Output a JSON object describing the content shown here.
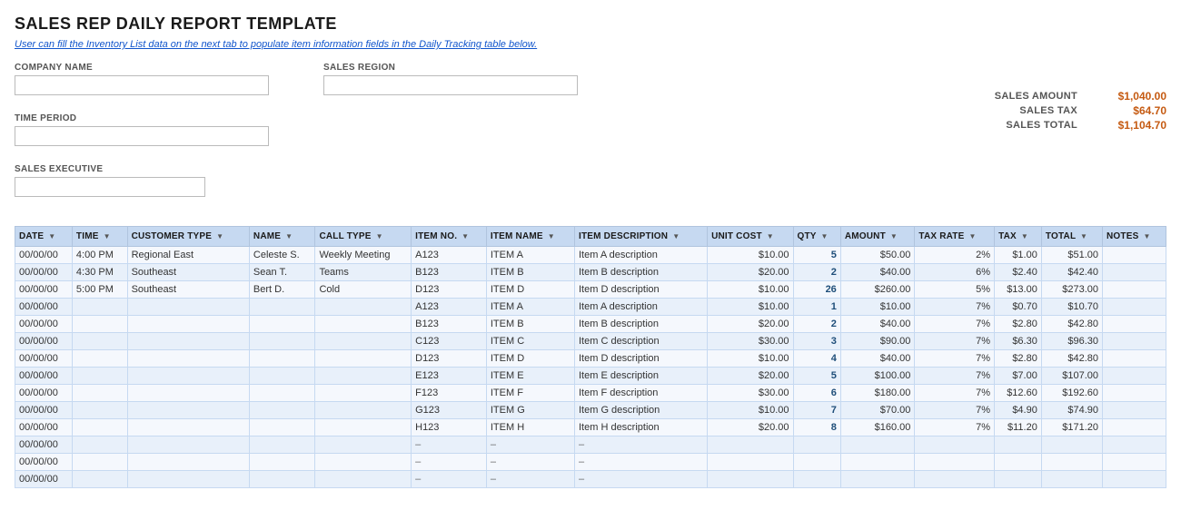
{
  "title": "SALES REP DAILY REPORT TEMPLATE",
  "subtitle_pre": "User can fill the Inventory List data on the next tab to populate item information fields in the ",
  "subtitle_link": "Daily Tracking",
  "subtitle_post": " table below.",
  "fields": {
    "company_name_label": "COMPANY NAME",
    "company_name_value": "",
    "sales_region_label": "SALES REGION",
    "sales_region_value": "",
    "time_period_label": "TIME PERIOD",
    "time_period_value": "",
    "sales_executive_label": "SALES EXECUTIVE",
    "sales_executive_value": ""
  },
  "summary": {
    "sales_amount_label": "SALES AMOUNT",
    "sales_amount_value": "$1,040.00",
    "sales_tax_label": "SALES TAX",
    "sales_tax_value": "$64.70",
    "sales_total_label": "SALES TOTAL",
    "sales_total_value": "$1,104.70"
  },
  "table": {
    "headers": [
      "DATE",
      "TIME",
      "CUSTOMER TYPE",
      "NAME",
      "CALL TYPE",
      "ITEM NO.",
      "ITEM NAME",
      "ITEM DESCRIPTION",
      "UNIT COST",
      "QTY",
      "AMOUNT",
      "TAX RATE",
      "TAX",
      "TOTAL",
      "NOTES"
    ],
    "rows": [
      [
        "00/00/00",
        "4:00 PM",
        "Regional East",
        "Celeste S.",
        "Weekly Meeting",
        "A123",
        "ITEM A",
        "Item A description",
        "$10.00",
        "5",
        "$50.00",
        "2%",
        "$1.00",
        "$51.00",
        ""
      ],
      [
        "00/00/00",
        "4:30 PM",
        "Southeast",
        "Sean T.",
        "Teams",
        "B123",
        "ITEM B",
        "Item B description",
        "$20.00",
        "2",
        "$40.00",
        "6%",
        "$2.40",
        "$42.40",
        ""
      ],
      [
        "00/00/00",
        "5:00 PM",
        "Southeast",
        "Bert D.",
        "Cold",
        "D123",
        "ITEM D",
        "Item D description",
        "$10.00",
        "26",
        "$260.00",
        "5%",
        "$13.00",
        "$273.00",
        ""
      ],
      [
        "00/00/00",
        "",
        "",
        "",
        "",
        "A123",
        "ITEM A",
        "Item A description",
        "$10.00",
        "1",
        "$10.00",
        "7%",
        "$0.70",
        "$10.70",
        ""
      ],
      [
        "00/00/00",
        "",
        "",
        "",
        "",
        "B123",
        "ITEM B",
        "Item B description",
        "$20.00",
        "2",
        "$40.00",
        "7%",
        "$2.80",
        "$42.80",
        ""
      ],
      [
        "00/00/00",
        "",
        "",
        "",
        "",
        "C123",
        "ITEM C",
        "Item C description",
        "$30.00",
        "3",
        "$90.00",
        "7%",
        "$6.30",
        "$96.30",
        ""
      ],
      [
        "00/00/00",
        "",
        "",
        "",
        "",
        "D123",
        "ITEM D",
        "Item D description",
        "$10.00",
        "4",
        "$40.00",
        "7%",
        "$2.80",
        "$42.80",
        ""
      ],
      [
        "00/00/00",
        "",
        "",
        "",
        "",
        "E123",
        "ITEM E",
        "Item E description",
        "$20.00",
        "5",
        "$100.00",
        "7%",
        "$7.00",
        "$107.00",
        ""
      ],
      [
        "00/00/00",
        "",
        "",
        "",
        "",
        "F123",
        "ITEM F",
        "Item F description",
        "$30.00",
        "6",
        "$180.00",
        "7%",
        "$12.60",
        "$192.60",
        ""
      ],
      [
        "00/00/00",
        "",
        "",
        "",
        "",
        "G123",
        "ITEM G",
        "Item G description",
        "$10.00",
        "7",
        "$70.00",
        "7%",
        "$4.90",
        "$74.90",
        ""
      ],
      [
        "00/00/00",
        "",
        "",
        "",
        "",
        "H123",
        "ITEM H",
        "Item H description",
        "$20.00",
        "8",
        "$160.00",
        "7%",
        "$11.20",
        "$171.20",
        ""
      ],
      [
        "00/00/00",
        "",
        "",
        "",
        "",
        "–",
        "–",
        "–",
        "",
        "",
        "",
        "",
        "",
        "",
        ""
      ],
      [
        "00/00/00",
        "",
        "",
        "",
        "",
        "–",
        "–",
        "–",
        "",
        "",
        "",
        "",
        "",
        "",
        ""
      ],
      [
        "00/00/00",
        "",
        "",
        "",
        "",
        "–",
        "–",
        "–",
        "",
        "",
        "",
        "",
        "",
        "",
        ""
      ]
    ]
  }
}
